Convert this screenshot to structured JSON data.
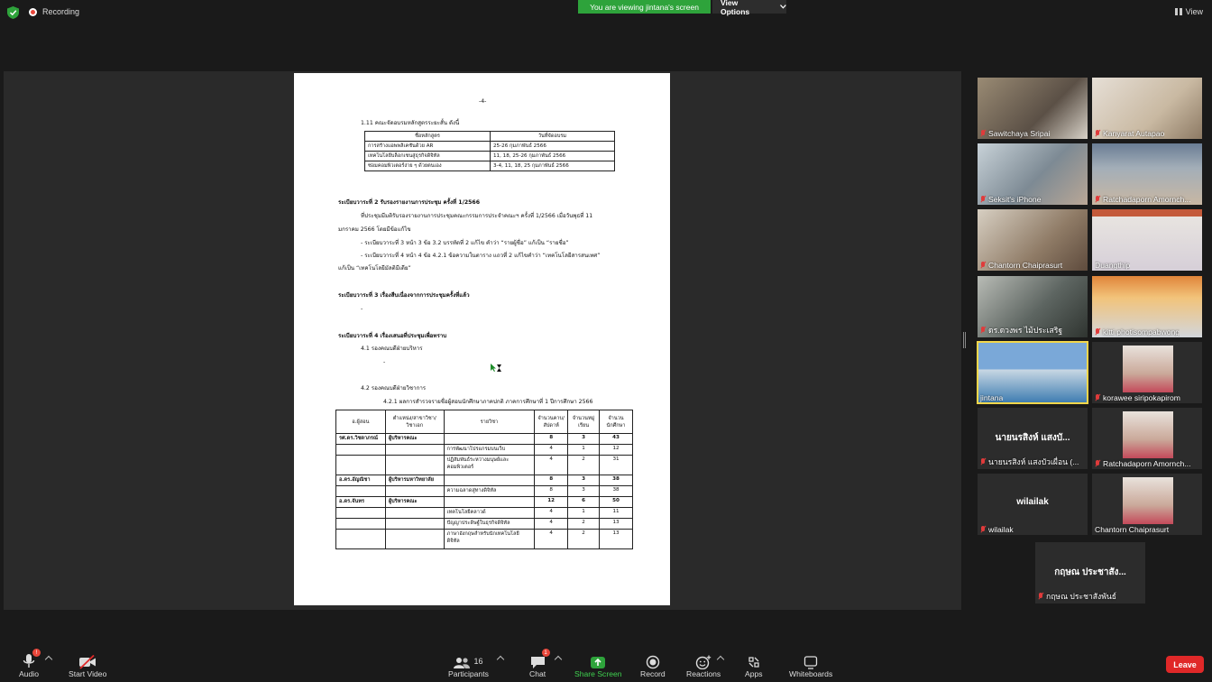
{
  "topbar": {
    "recording_label": "Recording",
    "viewing_banner": "You are viewing jintana's screen",
    "view_options_label": "View Options",
    "view_label": "View"
  },
  "document": {
    "page_number": "-4-",
    "sec_1_11_heading": "1.11 คณะจัดอบรมหลักสูตรระยะสั้น ดังนี้",
    "course_table": {
      "headers": [
        "ชื่อหลักสูตร",
        "วันที่จัดอบรม"
      ],
      "rows": [
        [
          "การสร้างแอพพลิเคชันด้วย AR",
          "25-26 กุมภาพันธ์ 2566"
        ],
        [
          "เทคโนโลยีบล็อกเชนสู่ธุรกิจดิจิทัล",
          "11, 18, 25-26 กุมภาพันธ์ 2566"
        ],
        [
          "ซ่อมคอมพิวเตอร์ง่าย ๆ ด้วยตนเอง",
          "3-4, 11, 18, 25 กุมภาพันธ์ 2566"
        ]
      ]
    },
    "agenda2_heading": "ระเบียบวาระที่  2   รับรองรายงานการประชุม ครั้งที่  1/2566",
    "agenda2_body1": "ที่ประชุมมีมติรับรองรายงานการประชุมคณะกรรมการประจำคณะฯ ครั้งที่ 1/2566  เมื่อวันพุธที่  11",
    "agenda2_body2": "มกราคม  2566  โดยมีข้อแก้ไข",
    "agenda2_fix1": "- ระเบียบวาระที่ 3 หน้า 3 ข้อ 3.2 บรรทัดที่ 2 แก้ไข คำว่า  “รายผู้ชื่อ” แก้เป็น “รายชื่อ”",
    "agenda2_fix2": "- ระเบียบวาระที่ 4 หน้า 4 ข้อ 4.2.1 ข้อความในตาราง แถวที่ 2 แก้ไขคำว่า “เทคโนโลยีสารสนเทศ”",
    "agenda2_fix3": "แก้เป็น “เทคโนโลยีมัลติมีเดีย”",
    "agenda3_heading": "ระเบียบวาระที่  3    เรื่องสืบเนื่องจากการประชุมครั้งที่แล้ว",
    "dash": "-",
    "agenda4_heading": "ระเบียบวาระที่  4    เรื่องเสนอที่ประชุมเพื่อทราบ",
    "item_4_1": "4.1  รองคณบดีฝ่ายบริหาร",
    "item_4_2": "4.2  รองคณบดีฝ่ายวิชาการ",
    "item_4_2_1": "4.2.1 ผลการสำรวจรายชื่อผู้สอนนักศึกษาภาคปกติ ภาคการศึกษาที่ 1 ปีการศึกษา 2566",
    "teach_table": {
      "headers": [
        "อ.ผู้สอน",
        "ตำแหน่ง/สาขาวิชา/วิชาเอก",
        "รายวิชา",
        "จำนวนคาบ/สัปดาห์",
        "จำนวนหมู่เรียน",
        "จำนวนนักศึกษา"
      ],
      "rows": [
        {
          "bold": true,
          "cells": [
            "รศ.ดร.วิชดาภรณ์",
            "ผู้บริหารคณะ",
            "",
            "8",
            "3",
            "43"
          ]
        },
        {
          "bold": false,
          "cells": [
            "",
            "",
            "การพัฒนาโปรแกรมบนเว็บ",
            "4",
            "1",
            "12"
          ]
        },
        {
          "bold": false,
          "cells": [
            "",
            "",
            "ปฏิสัมพันธ์ระหว่างมนุษย์และคอมพิวเตอร์",
            "4",
            "2",
            "31"
          ]
        },
        {
          "bold": true,
          "cells": [
            "อ.ดร.อัญณิชา",
            "ผู้บริหารมหาวิทยาลัย",
            "",
            "8",
            "3",
            "38"
          ]
        },
        {
          "bold": false,
          "cells": [
            "",
            "",
            "ความฉลาดสู่ทางดิจิทัล",
            "8",
            "3",
            "38"
          ]
        },
        {
          "bold": true,
          "cells": [
            "อ.ดร.จันทร",
            "ผู้บริหารคณะ",
            "",
            "12",
            "6",
            "50"
          ]
        },
        {
          "bold": false,
          "cells": [
            "",
            "",
            "เทคโนโลยีคลาวด์",
            "4",
            "1",
            "11"
          ]
        },
        {
          "bold": false,
          "cells": [
            "",
            "",
            "ปัญญาประดิษฐ์ในธุรกิจดิจิทัล",
            "4",
            "2",
            "13"
          ]
        },
        {
          "bold": false,
          "cells": [
            "",
            "",
            "ภาษาอังกฤษสำหรับนักเทคโนโลยีดิจิทัล",
            "4",
            "2",
            "13"
          ]
        }
      ]
    }
  },
  "participants": [
    {
      "name": "Sawitchaya Sripai",
      "muted": true
    },
    {
      "name": "Kanyarat Autapao",
      "muted": true
    },
    {
      "name": "Seksit's iPhone",
      "muted": true
    },
    {
      "name": "Ratchadaporn Amornch...",
      "muted": true
    },
    {
      "name": "Chantorn Chaiprasurt",
      "muted": true
    },
    {
      "name": "Duangthip",
      "muted": false
    },
    {
      "name": "ดร.ดวงพร ไม้ประเสริฐ",
      "muted": true
    },
    {
      "name": "kitti photisompabwong",
      "muted": true
    },
    {
      "name": "jintana",
      "muted": false
    },
    {
      "name": "korawee siripokapirom",
      "muted": true
    },
    {
      "name": "นายนรสิงห์ แสงบัวเผื่อน (...",
      "muted": true,
      "big": "นายนรสิงห์ แสงบั..."
    },
    {
      "name": "Ratchadaporn Amornch...",
      "muted": true
    },
    {
      "name": "wilailak",
      "muted": true,
      "big": "wilailak"
    },
    {
      "name": "Chantorn Chaiprasurt",
      "muted": false
    },
    {
      "name": "กฤษณ ประชาสังพันธ์",
      "muted": true,
      "big": "กฤษณ ประชาสัง..."
    }
  ],
  "toolbar": {
    "audio": "Audio",
    "start_video": "Start Video",
    "participants": "Participants",
    "participants_count": "16",
    "chat": "Chat",
    "chat_badge": "1",
    "audio_badge": "!",
    "share_screen": "Share Screen",
    "record": "Record",
    "reactions": "Reactions",
    "apps": "Apps",
    "whiteboards": "Whiteboards",
    "leave": "Leave"
  },
  "colors": {
    "share_green": "#2ea33b",
    "leave_red": "#e02828",
    "active_speaker": "#f2d64b"
  }
}
